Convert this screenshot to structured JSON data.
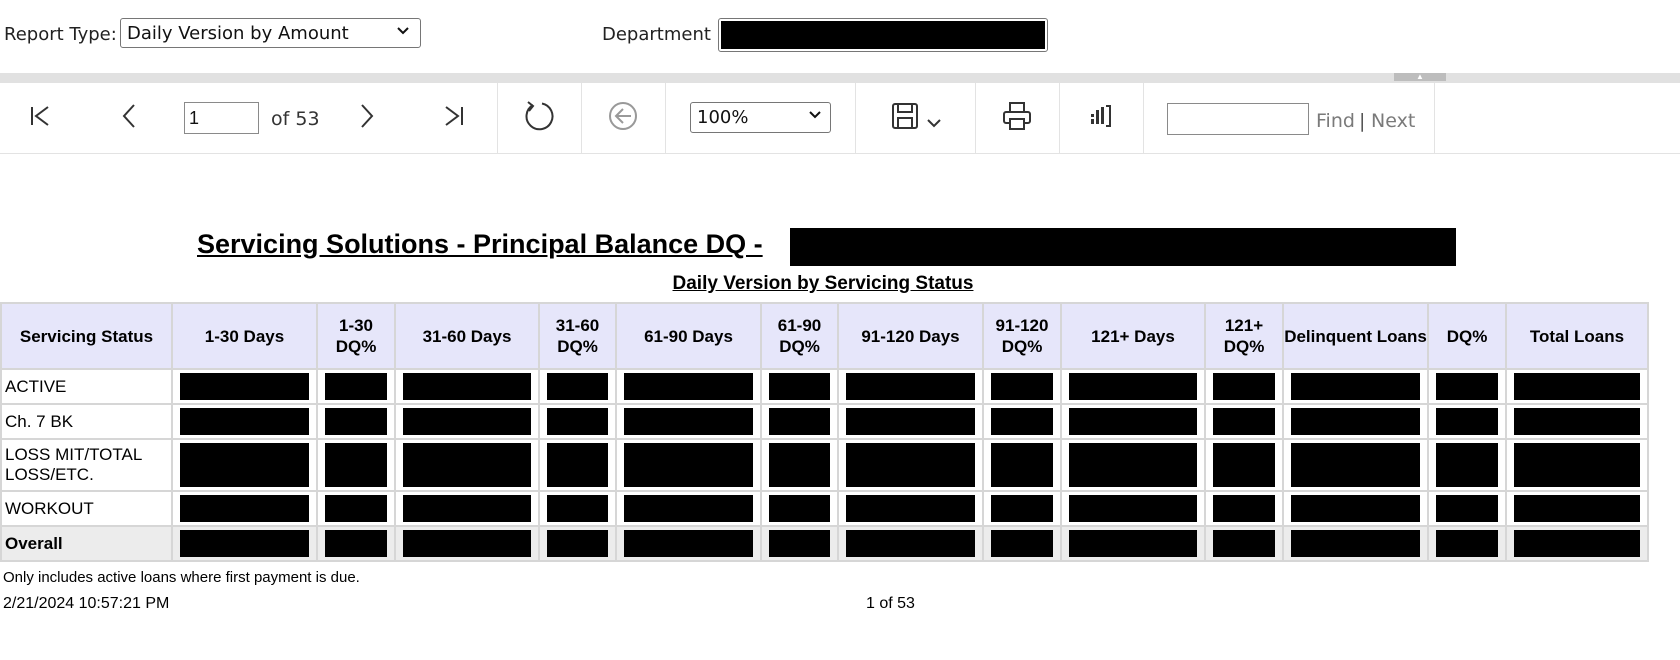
{
  "params": {
    "report_type_label": "Report Type:",
    "report_type_value": "Daily Version by Amount",
    "department_label": "Department"
  },
  "toolbar": {
    "page_current": "1",
    "page_of": "of 53",
    "zoom_value": "100%",
    "find_placeholder": "",
    "find_label": "Find",
    "separator": "|",
    "next_label": "Next"
  },
  "icons": [
    "first-page-icon",
    "previous-page-icon",
    "next-page-icon",
    "last-page-icon",
    "refresh-icon",
    "back-icon",
    "save-icon",
    "print-icon",
    "power-bi-icon"
  ],
  "report": {
    "title": "Servicing Solutions - Principal Balance DQ -",
    "subtitle": "Daily Version by Servicing Status",
    "columns": [
      "Servicing Status",
      "1-30 Days",
      "1-30 DQ%",
      "31-60 Days",
      "31-60 DQ%",
      "61-90 Days",
      "61-90 DQ%",
      "91-120 Days",
      "91-120 DQ%",
      "121+ Days",
      "121+ DQ%",
      "Delinquent Loans",
      "DQ%",
      "Total Loans"
    ],
    "rows": [
      {
        "status": "ACTIVE"
      },
      {
        "status": "Ch. 7 BK"
      },
      {
        "status": "LOSS MIT/TOTAL LOSS/ETC."
      },
      {
        "status": "WORKOUT"
      },
      {
        "status": "Overall"
      }
    ],
    "footnote": "Only includes active loans where first payment is due.",
    "timestamp": "2/21/2024 10:57:21 PM",
    "page_footer": "1 of 53"
  }
}
